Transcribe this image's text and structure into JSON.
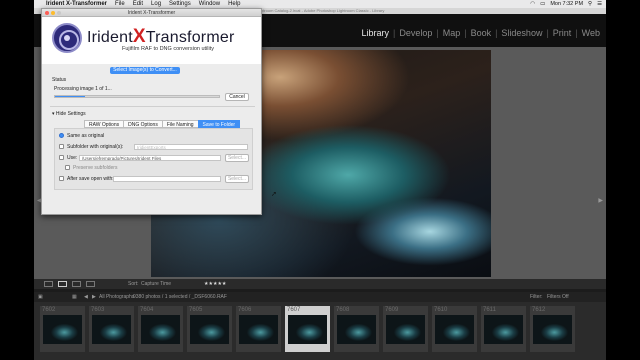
{
  "menubar": {
    "app": "Irident X-Transformer",
    "items": [
      "File",
      "Edit",
      "Log",
      "Settings",
      "Window",
      "Help"
    ],
    "clock": "Mon 7:32 PM"
  },
  "lightroom": {
    "window_title": "Lightroom Catalog-2.lrcat - Adobe Photoshop Lightroom Classic - Library",
    "modules": [
      "Library",
      "Develop",
      "Map",
      "Book",
      "Slideshow",
      "Print",
      "Web"
    ],
    "active_module": "Library",
    "toolbar": {
      "sort_label": "Sort:",
      "sort_value": "Capture Time",
      "stars": "★★★★★"
    },
    "strip_nav": {
      "source": "All Photographs",
      "info": "9380 photos / 1 selected / _DSF6060.RAF",
      "filter_label": "Filter:",
      "filter_value": "Filters Off"
    },
    "filmstrip": [
      {
        "num": "7602"
      },
      {
        "num": "7603"
      },
      {
        "num": "7604"
      },
      {
        "num": "7605"
      },
      {
        "num": "7606"
      },
      {
        "num": "7607",
        "selected": true
      },
      {
        "num": "7608"
      },
      {
        "num": "7609"
      },
      {
        "num": "7610"
      },
      {
        "num": "7611"
      },
      {
        "num": "7612"
      }
    ]
  },
  "xt": {
    "title": "Irident X-Transformer",
    "brand_prefix": "Irident",
    "brand_x": "X",
    "brand_suffix": "Transformer",
    "tagline": "Fujifilm RAF to DNG conversion utility",
    "convert_button": "Select Image(s) to Convert...",
    "status_label": "Status",
    "status_text": "Processing image 1 of 1...",
    "progress": 0.18,
    "cancel_button": "Cancel",
    "hide_settings": "Hide Settings",
    "tabs": [
      "RAW Options",
      "DNG Options",
      "File Naming",
      "Save to Folder"
    ],
    "active_tab": "Save to Folder",
    "opt_same": "Same as original",
    "opt_subfolder": "Subfolder with original(s):",
    "subfolder_placeholder": "IridientExports",
    "opt_use": "Use:",
    "use_path": "/Users/efremprado/Pictures/Irident Files",
    "select_button": "Select...",
    "preserve_label": "Preserve subfolders",
    "after_save_label": "After save open with:",
    "select_button_2": "Select..."
  },
  "colors": {
    "accent": "#3f8ff5",
    "brand_x": "#d12121"
  }
}
